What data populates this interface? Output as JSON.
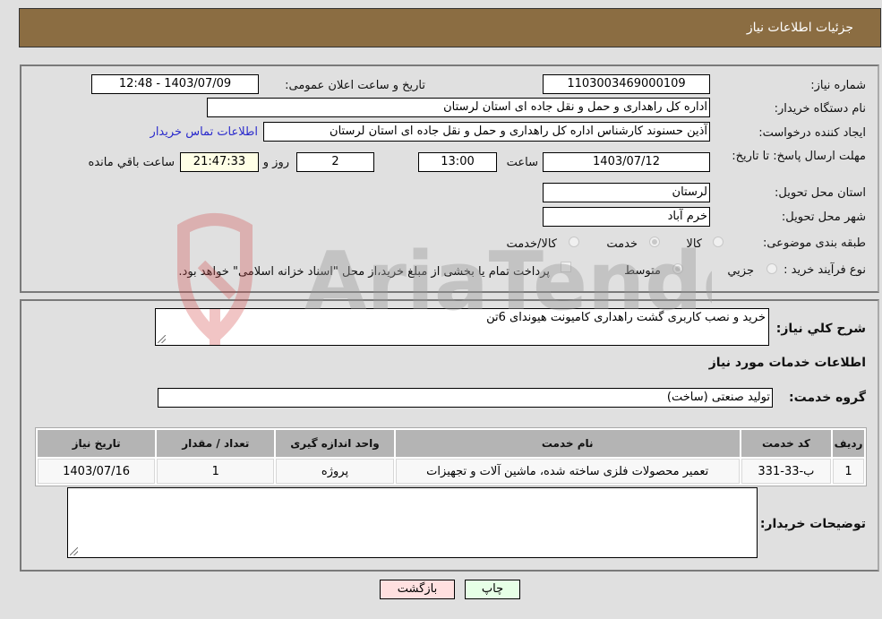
{
  "header": {
    "title": "جزئیات اطلاعات نیاز"
  },
  "details": {
    "need_number_label": "شماره نیاز:",
    "need_number": "1103003469000109",
    "announce_label": "تاریخ و ساعت اعلان عمومی:",
    "announce_value": "1403/07/09 - 12:48",
    "buyer_org_label": "نام دستگاه خریدار:",
    "buyer_org": "اداره کل راهداری و حمل و نقل جاده ای استان لرستان",
    "creator_label": "ایجاد کننده درخواست:",
    "creator": "آذین حسنوند کارشناس اداره کل راهداری و حمل و نقل جاده ای استان لرستان",
    "contact_link": "اطلاعات تماس خریدار",
    "deadline_label": "مهلت ارسال پاسخ: تا تاریخ:",
    "deadline_date": "1403/07/12",
    "time_label": "ساعت",
    "deadline_time": "13:00",
    "days_value": "2",
    "days_label": "روز و",
    "remaining_time": "21:47:33",
    "remaining_label": "ساعت باقي مانده",
    "province_label": "استان محل تحویل:",
    "province": "لرستان",
    "city_label": "شهر محل تحویل:",
    "city": "خرم آباد",
    "category_label": "طبقه بندی موضوعی:",
    "category_options": [
      {
        "label": "کالا",
        "checked": false
      },
      {
        "label": "خدمت",
        "checked": true
      },
      {
        "label": "کالا/خدمت",
        "checked": false
      }
    ],
    "process_label": "نوع فرآیند خرید :",
    "process_options": [
      {
        "label": "جزیي",
        "checked": false
      },
      {
        "label": "متوسط",
        "checked": true
      }
    ],
    "treasury_note": "پرداخت تمام یا بخشی از مبلغ خرید،از محل \"اسناد خزانه اسلامی\" خواهد بود."
  },
  "description": {
    "label": "شرح کلي نیاز:",
    "value": "خرید و نصب کاربری گشت راهداری کامیونت هیوندای 6تن"
  },
  "services_section": {
    "title": "اطلاعات خدمات مورد نیاز",
    "group_label": "گروه خدمت:",
    "group_value": "تولید صنعتی (ساخت)",
    "table": {
      "headers": [
        "ردیف",
        "کد خدمت",
        "نام خدمت",
        "واحد اندازه گیری",
        "تعداد / مقدار",
        "تاریخ نیاز"
      ],
      "rows": [
        [
          "1",
          "ب-33-331",
          "تعمیر محصولات فلزی ساخته شده، ماشین آلات و تجهیزات",
          "پروژه",
          "1",
          "1403/07/16"
        ]
      ]
    }
  },
  "buyer_notes": {
    "label": "توضیحات خریدار:",
    "value": ""
  },
  "buttons": {
    "print": "چاپ",
    "back": "بازگشت"
  },
  "watermark": {
    "text": "AriaTender.neT"
  }
}
